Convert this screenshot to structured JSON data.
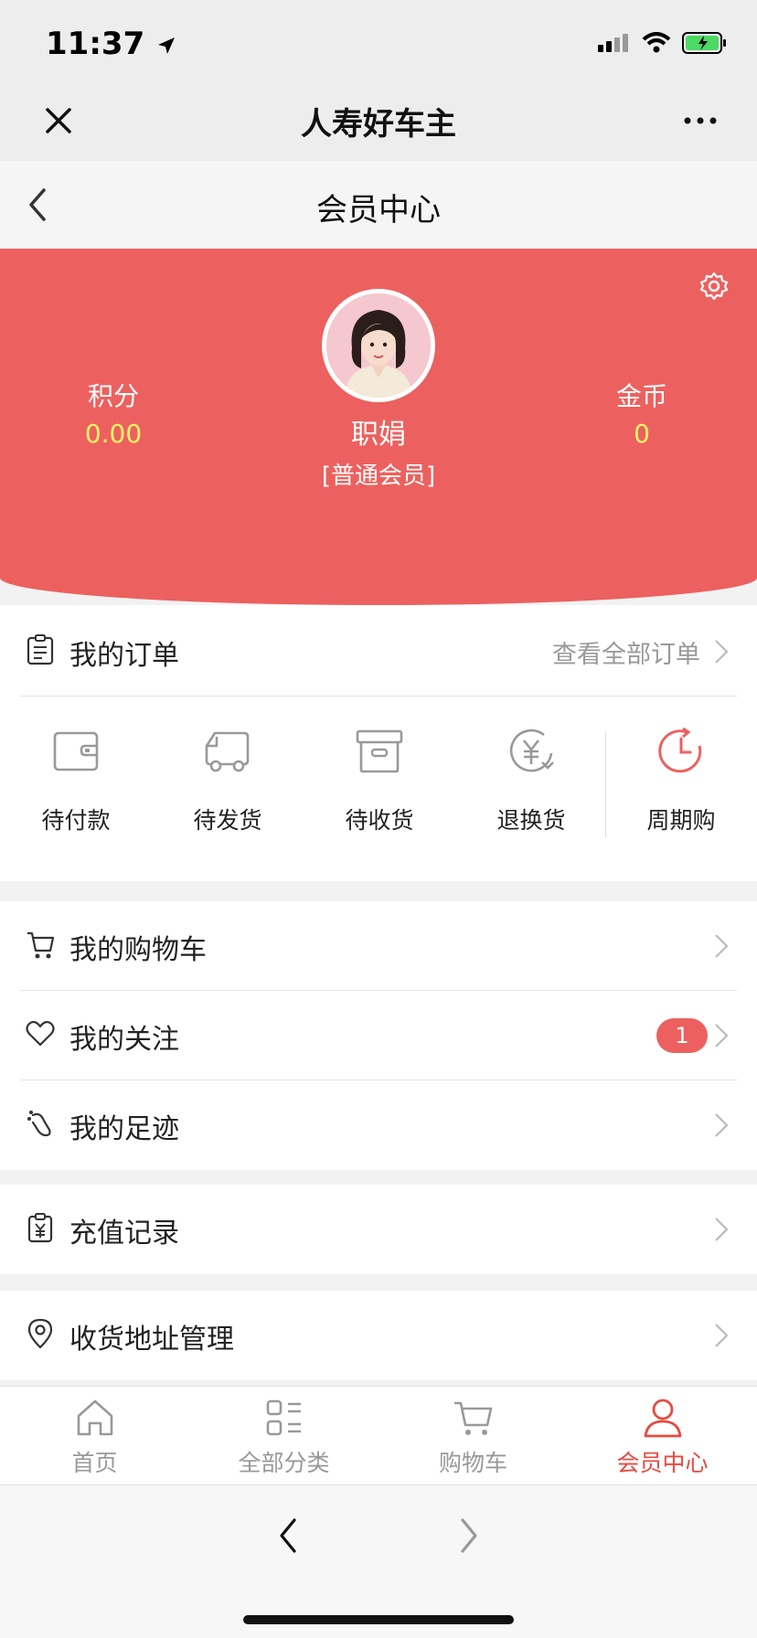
{
  "status_bar": {
    "time": "11:37"
  },
  "wechat": {
    "title": "人寿好车主"
  },
  "page": {
    "title": "会员中心"
  },
  "profile": {
    "name": "职娟",
    "level": "[普通会员]",
    "points_label": "积分",
    "points_value": "0.00",
    "coins_label": "金币",
    "coins_value": "0"
  },
  "orders": {
    "title": "我的订单",
    "view_all": "查看全部订单",
    "items": [
      {
        "label": "待付款",
        "icon": "wallet-icon"
      },
      {
        "label": "待发货",
        "icon": "truck-icon"
      },
      {
        "label": "待收货",
        "icon": "box-icon"
      },
      {
        "label": "退换货",
        "icon": "yen-refresh-icon"
      },
      {
        "label": "周期购",
        "icon": "clock-cycle-icon"
      }
    ]
  },
  "menu": [
    {
      "label": "我的购物车",
      "icon": "cart-icon"
    },
    {
      "label": "我的关注",
      "icon": "heart-icon",
      "badge": "1"
    },
    {
      "label": "我的足迹",
      "icon": "footprint-icon"
    },
    {
      "label": "充值记录",
      "icon": "clipboard-yen-icon"
    },
    {
      "label": "收货地址管理",
      "icon": "location-pin-icon"
    }
  ],
  "tabbar": [
    {
      "label": "首页",
      "icon": "home-icon",
      "active": false
    },
    {
      "label": "全部分类",
      "icon": "categories-icon",
      "active": false
    },
    {
      "label": "购物车",
      "icon": "cart-icon",
      "active": false
    },
    {
      "label": "会员中心",
      "icon": "user-icon",
      "active": true
    }
  ],
  "colors": {
    "accent": "#ec615f",
    "points_value": "#fff267",
    "active_tab": "#e84a3f"
  }
}
